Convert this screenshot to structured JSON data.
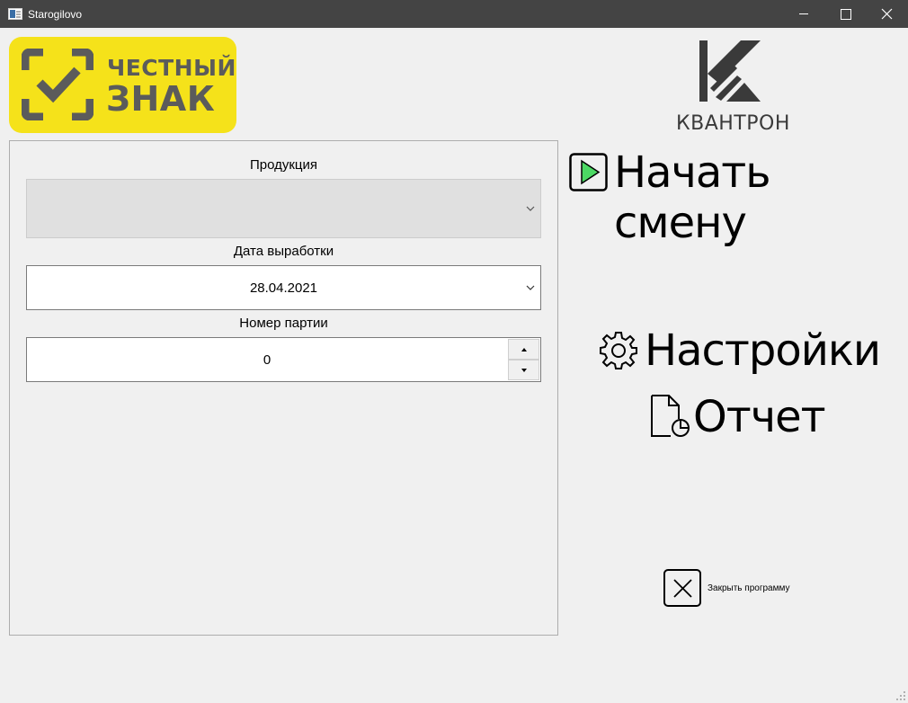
{
  "window": {
    "title": "Starogilovo",
    "minimize_icon": "minimize-icon",
    "maximize_icon": "maximize-icon",
    "close_icon": "close-icon"
  },
  "logos": {
    "chestny_znak": {
      "line1": "ЧЕСТНЫЙ",
      "line2": "ЗНАК",
      "bg_color": "#f5e21a",
      "text_color": "#5b5b5b"
    },
    "kvantron": {
      "text": "КВАНТРОН",
      "color": "#3a3a3a"
    }
  },
  "form": {
    "product": {
      "label": "Продукция",
      "value": "",
      "enabled": false
    },
    "production_date": {
      "label": "Дата выработки",
      "value": "28.04.2021"
    },
    "batch_number": {
      "label": "Номер партии",
      "value": "0"
    }
  },
  "actions": {
    "start_shift": {
      "label": "Начать смену",
      "icon": "play-icon",
      "icon_color": "#4cd964"
    },
    "settings": {
      "label": "Настройки",
      "icon": "gear-icon"
    },
    "report": {
      "label": "Отчет",
      "icon": "report-document-icon"
    },
    "close_program": {
      "label": "Закрыть программу",
      "icon": "close-x-icon"
    }
  }
}
